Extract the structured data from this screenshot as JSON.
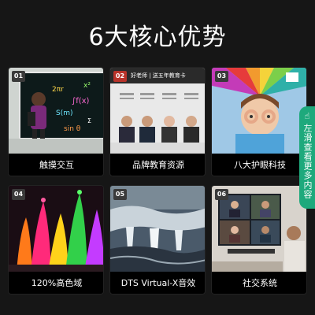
{
  "page": {
    "title": "6大核心优势"
  },
  "cards": [
    {
      "num": "01",
      "caption": "触摸交互"
    },
    {
      "num": "02",
      "caption": "品牌教育资源",
      "banner": "好老师 | 送五年教育卡"
    },
    {
      "num": "03",
      "caption": "八大护眼科技"
    },
    {
      "num": "04",
      "caption": "120%高色域"
    },
    {
      "num": "05",
      "caption": "DTS Virtual-X音效"
    },
    {
      "num": "06",
      "caption": "社交系统"
    }
  ],
  "side_tab": {
    "label": "左滑查看更多内容",
    "icon": "hand-swipe-icon"
  },
  "colors": {
    "accent": "#1ea97c",
    "background": "#161616"
  }
}
